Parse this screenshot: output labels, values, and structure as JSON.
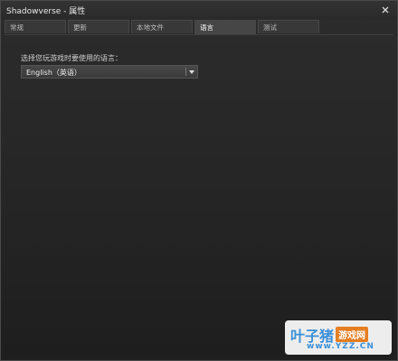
{
  "window": {
    "title": "Shadowverse - 属性"
  },
  "tabs": [
    {
      "label": "常规"
    },
    {
      "label": "更新"
    },
    {
      "label": "本地文件"
    },
    {
      "label": "语言",
      "active": true
    },
    {
      "label": "测试"
    }
  ],
  "language": {
    "prompt": "选择您玩游戏时要使用的语言：",
    "selected": "English（英语）"
  },
  "watermark": {
    "brand": "叶子猪",
    "tag": "游戏网",
    "url": "www.YZZ.CN"
  },
  "icons": {
    "close": "close-icon",
    "dropdown": "chevron-down-icon"
  }
}
